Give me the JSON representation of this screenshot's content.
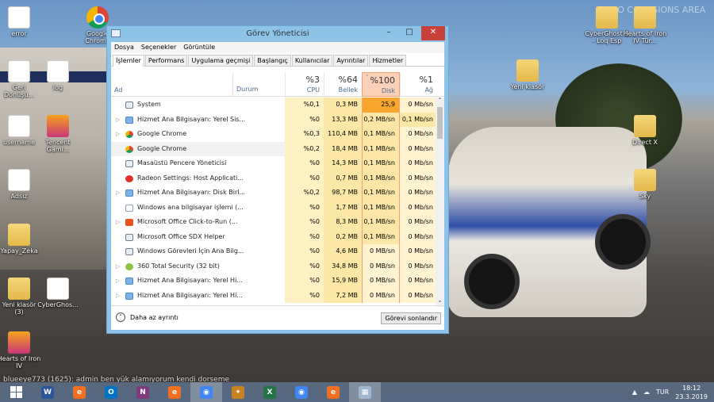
{
  "wallpaper_text": "NO COLLISIONS AREA",
  "desktop_icons": [
    {
      "label": "error",
      "type": "doc"
    },
    {
      "label": "Google Chrome",
      "type": "chrome"
    },
    {
      "label": "Geri Dönüşü...",
      "type": "doc"
    },
    {
      "label": "log",
      "type": "doc"
    },
    {
      "label": "username",
      "type": "doc"
    },
    {
      "label": "Tencent Gami...",
      "type": "app"
    },
    {
      "label": "Adsız",
      "type": "doc"
    },
    {
      "label": "Yapay_Zeka",
      "type": "folder"
    },
    {
      "label": "Yeni klasör (3)",
      "type": "folder"
    },
    {
      "label": "CyberGhos...",
      "type": "doc"
    },
    {
      "label": "Hearts of Iron IV",
      "type": "app"
    },
    {
      "label": "CyberGhost 6 - Loq Esp",
      "type": "folder"
    },
    {
      "label": "Hearts of Iron IV Tür...",
      "type": "folder"
    },
    {
      "label": "Yeni klasör",
      "type": "folder"
    },
    {
      "label": "Direct X",
      "type": "folder"
    },
    {
      "label": "Sky",
      "type": "folder"
    }
  ],
  "window": {
    "title": "Görev Yöneticisi",
    "menu": [
      "Dosya",
      "Seçenekler",
      "Görüntüle"
    ],
    "tabs": [
      "İşlemler",
      "Performans",
      "Uygulama geçmişi",
      "Başlangıç",
      "Kullanıcılar",
      "Ayrıntılar",
      "Hizmetler"
    ],
    "active_tab": "İşlemler",
    "columns": {
      "name": "Ad",
      "status": "Durum",
      "cpu": {
        "pct": "%3",
        "label": "CPU"
      },
      "memory": {
        "pct": "%64",
        "label": "Bellek"
      },
      "disk": {
        "pct": "%100",
        "label": "Disk"
      },
      "network": {
        "pct": "%1",
        "label": "Ağ"
      }
    },
    "sorted_column": "Disk",
    "processes": [
      {
        "name": "System",
        "icon": "window",
        "expand": false,
        "cpu": "%0,1",
        "mem": "0,3 MB",
        "disk": "25,9 MB/sn",
        "net": "0 Mb/sn"
      },
      {
        "name": "Hizmet Ana Bilgisayarı: Yerel Sis...",
        "icon": "gear",
        "expand": true,
        "cpu": "%0",
        "mem": "13,3 MB",
        "disk": "0,2 MB/sn",
        "net": "0,1 Mb/sn"
      },
      {
        "name": "Google Chrome",
        "icon": "chrome",
        "expand": true,
        "cpu": "%0,3",
        "mem": "110,4 MB",
        "disk": "0,1 MB/sn",
        "net": "0 Mb/sn"
      },
      {
        "name": "Google Chrome",
        "icon": "chrome",
        "expand": false,
        "cpu": "%0,2",
        "mem": "18,4 MB",
        "disk": "0,1 MB/sn",
        "net": "0 Mb/sn",
        "selected": true
      },
      {
        "name": "Masaüstü Pencere Yöneticisi",
        "icon": "window",
        "expand": false,
        "cpu": "%0",
        "mem": "14,3 MB",
        "disk": "0,1 MB/sn",
        "net": "0 Mb/sn"
      },
      {
        "name": "Radeon Settings: Host Applicati...",
        "icon": "radeon",
        "expand": false,
        "cpu": "%0",
        "mem": "0,7 MB",
        "disk": "0,1 MB/sn",
        "net": "0 Mb/sn"
      },
      {
        "name": "Hizmet Ana Bilgisayarı: Disk Birl...",
        "icon": "gear",
        "expand": true,
        "cpu": "%0,2",
        "mem": "98,7 MB",
        "disk": "0,1 MB/sn",
        "net": "0 Mb/sn"
      },
      {
        "name": "Windows ana bilgisayar işlemi (...",
        "icon": "doc",
        "expand": false,
        "cpu": "%0",
        "mem": "1,7 MB",
        "disk": "0,1 MB/sn",
        "net": "0 Mb/sn"
      },
      {
        "name": "Microsoft Office Click-to-Run (...",
        "icon": "office",
        "expand": true,
        "cpu": "%0",
        "mem": "8,3 MB",
        "disk": "0,1 MB/sn",
        "net": "0 Mb/sn"
      },
      {
        "name": "Microsoft Office SDX Helper",
        "icon": "window",
        "expand": false,
        "cpu": "%0",
        "mem": "0,2 MB",
        "disk": "0,1 MB/sn",
        "net": "0 Mb/sn"
      },
      {
        "name": "Windows Görevleri İçin Ana Bilg...",
        "icon": "window",
        "expand": false,
        "cpu": "%0",
        "mem": "4,6 MB",
        "disk": "0 MB/sn",
        "net": "0 Mb/sn"
      },
      {
        "name": "360 Total Security (32 bit)",
        "icon": "360",
        "expand": true,
        "cpu": "%0",
        "mem": "34,8 MB",
        "disk": "0 MB/sn",
        "net": "0 Mb/sn"
      },
      {
        "name": "Hizmet Ana Bilgisayarı: Yerel Hi...",
        "icon": "gear",
        "expand": true,
        "cpu": "%0",
        "mem": "15,9 MB",
        "disk": "0 MB/sn",
        "net": "0 Mb/sn"
      },
      {
        "name": "Hizmet Ana Bilgisayarı: Yerel Hi...",
        "icon": "gear",
        "expand": true,
        "cpu": "%0",
        "mem": "7,2 MB",
        "disk": "0 MB/sn",
        "net": "0 Mb/sn"
      }
    ],
    "fewer_details": "Daha az ayrıntı",
    "end_task": "Görevi sonlandır"
  },
  "chat_line": "blueeye773 (1625): admin ben yük alamıyorum kendi dorseme",
  "taskbar": {
    "apps": [
      "Word",
      "Firefox",
      "Outlook",
      "OneNote",
      "Firefox",
      "Google Chrome",
      "Counter-Strike",
      "Excel",
      "Google Chrome",
      "Firefox",
      "Görev Yöneticisi"
    ],
    "active": "Google Chrome",
    "language": "TUR",
    "time": "18:12",
    "date": "23.3.2019"
  }
}
